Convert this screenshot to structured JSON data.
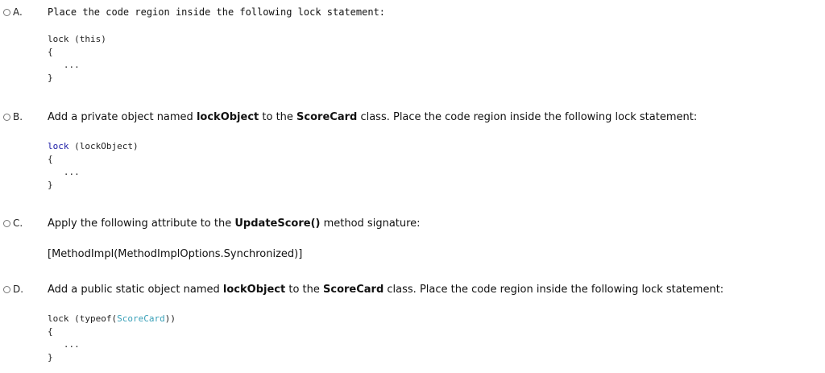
{
  "options": [
    {
      "letter": "A.",
      "text": "Place the code region inside the following lock statement:",
      "code": [
        "lock (this)",
        "{",
        "   ...",
        "}"
      ]
    },
    {
      "letter": "B.",
      "text_pre": "Add a private object named ",
      "bold1": "lockObject",
      "text_mid": " to the ",
      "bold2": "ScoreCard",
      "text_post": " class. Place the code region inside the following lock statement:",
      "code_kw": "lock",
      "code_line1_rest": " (lockObject)",
      "code": [
        "{",
        "   ...",
        "}"
      ]
    },
    {
      "letter": "C.",
      "text_pre": "Apply the following attribute to the ",
      "bold1": "UpdateScore()",
      "text_post": " method signature:",
      "attribute": "[MethodImpl(MethodImplOptions.Synchronized)]"
    },
    {
      "letter": "D.",
      "text_pre": "Add a public static object named ",
      "bold1": "lockObject",
      "text_mid": " to the ",
      "bold2": "ScoreCard",
      "text_post": " class. Place the code region inside the following lock statement:",
      "code_line1_pre": "lock (typeof(",
      "code_type": "ScoreCard",
      "code_line1_post": "))",
      "code": [
        "{",
        "   ...",
        "}"
      ]
    }
  ]
}
